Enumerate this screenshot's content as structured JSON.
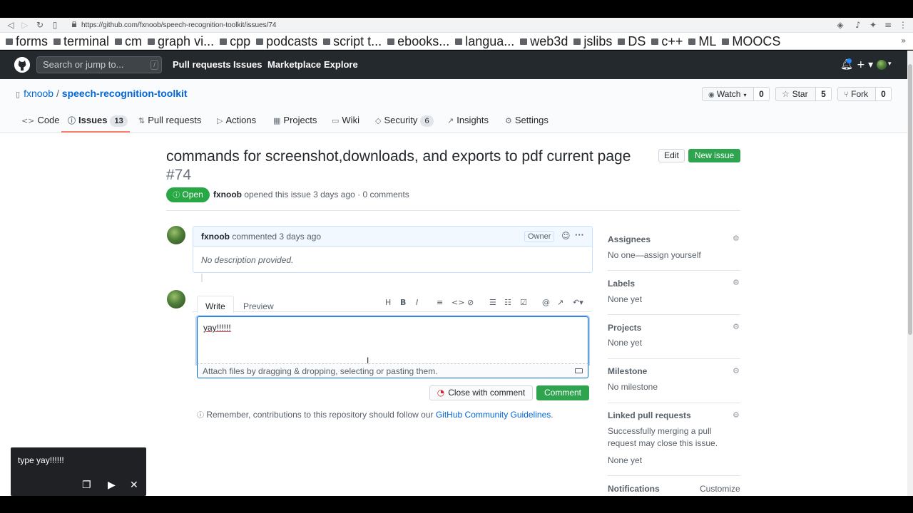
{
  "browser": {
    "url": "https://github.com/fxnoob/speech-recognition-toolkit/issues/74",
    "bookmarks": [
      "forms",
      "terminal",
      "cm",
      "graph vi...",
      "cpp",
      "podcasts",
      "script t...",
      "ebooks...",
      "langua...",
      "web3d",
      "jslibs",
      "DS",
      "c++",
      "ML",
      "MOOCS"
    ]
  },
  "header": {
    "search_placeholder": "Search or jump to...",
    "slash_key": "/",
    "nav": [
      "Pull requests",
      "Issues",
      "Marketplace",
      "Explore"
    ]
  },
  "repo": {
    "owner": "fxnoob",
    "separator": "/",
    "name": "speech-recognition-toolkit",
    "watch_label": "Watch",
    "watch_count": "0",
    "star_label": "Star",
    "star_count": "5",
    "fork_label": "Fork",
    "fork_count": "0",
    "tabs": [
      {
        "label": "Code",
        "count": ""
      },
      {
        "label": "Issues",
        "count": "13"
      },
      {
        "label": "Pull requests",
        "count": ""
      },
      {
        "label": "Actions",
        "count": ""
      },
      {
        "label": "Projects",
        "count": ""
      },
      {
        "label": "Wiki",
        "count": ""
      },
      {
        "label": "Security",
        "count": "6"
      },
      {
        "label": "Insights",
        "count": ""
      },
      {
        "label": "Settings",
        "count": ""
      }
    ]
  },
  "issue": {
    "title": "commands for screenshot,downloads, and exports to pdf current page",
    "number": "#74",
    "edit_label": "Edit",
    "new_issue_label": "New issue",
    "state": "Open",
    "author": "fxnoob",
    "meta": "opened this issue 3 days ago · 0 comments"
  },
  "comment": {
    "author": "fxnoob",
    "time": "commented 3 days ago",
    "role": "Owner",
    "body": "No description provided."
  },
  "composer": {
    "tab_write": "Write",
    "tab_preview": "Preview",
    "text": "yay!!!!!!",
    "attach_hint": "Attach files by dragging & dropping, selecting or pasting them.",
    "close_label": "Close with comment",
    "comment_label": "Comment",
    "remember_text": "Remember, contributions to this repository should follow our",
    "guidelines_link": "GitHub Community Guidelines",
    "remember_end": "."
  },
  "sidebar": {
    "assignees_label": "Assignees",
    "assignees_value": "No one—assign yourself",
    "labels_label": "Labels",
    "labels_value": "None yet",
    "projects_label": "Projects",
    "projects_value": "None yet",
    "milestone_label": "Milestone",
    "milestone_value": "No milestone",
    "linked_label": "Linked pull requests",
    "linked_desc": "Successfully merging a pull request may close this issue.",
    "linked_value": "None yet",
    "notifications_label": "Notifications",
    "customize_label": "Customize"
  },
  "toast": {
    "text": "type yay!!!!!!"
  }
}
